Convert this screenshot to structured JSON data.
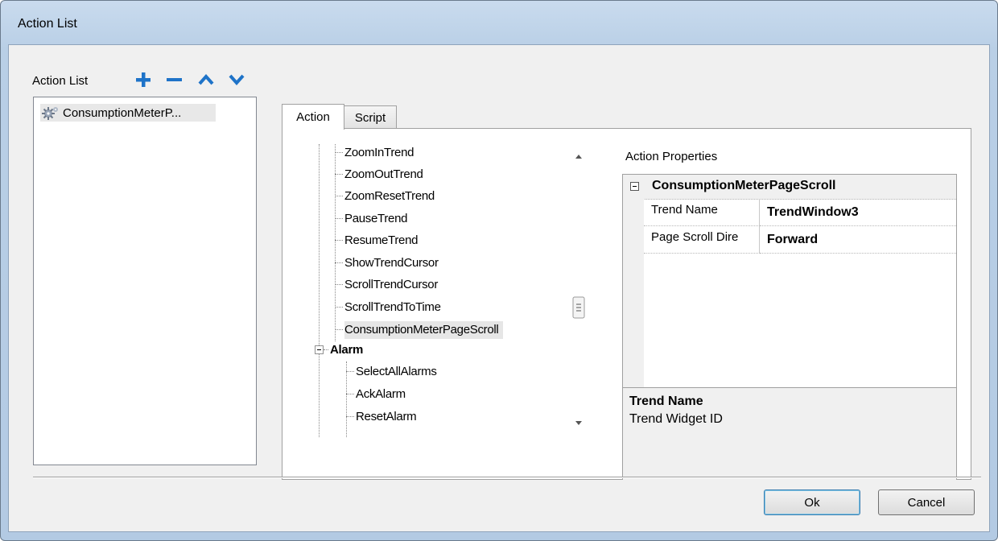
{
  "window": {
    "title": "Action List"
  },
  "toolbar": {
    "label": "Action List",
    "add_icon": "plus-icon",
    "remove_icon": "minus-icon",
    "up_icon": "chevron-up-icon",
    "down_icon": "chevron-down-icon",
    "accent": "#1e73c8"
  },
  "action_list": {
    "items": [
      {
        "label": "ConsumptionMeterP...",
        "icon": "gear-icon"
      }
    ]
  },
  "tabs": [
    {
      "label": "Action",
      "active": true
    },
    {
      "label": "Script",
      "active": false
    }
  ],
  "tree": {
    "items": [
      {
        "label": "ZoomInTrend"
      },
      {
        "label": "ZoomOutTrend"
      },
      {
        "label": "ZoomResetTrend"
      },
      {
        "label": "PauseTrend"
      },
      {
        "label": "ResumeTrend"
      },
      {
        "label": "ShowTrendCursor"
      },
      {
        "label": "ScrollTrendCursor"
      },
      {
        "label": "ScrollTrendToTime"
      },
      {
        "label": "ConsumptionMeterPageScroll",
        "selected": true
      },
      {
        "label": "Alarm",
        "group": true
      },
      {
        "label": "SelectAllAlarms"
      },
      {
        "label": "AckAlarm"
      },
      {
        "label": "ResetAlarm"
      }
    ]
  },
  "properties": {
    "heading": "Action Properties",
    "category": "ConsumptionMeterPageScroll",
    "rows": [
      {
        "name": "Trend Name",
        "value": "TrendWindow3"
      },
      {
        "name": "Page Scroll Dire",
        "value": "Forward"
      }
    ],
    "description_title": "Trend Name",
    "description_text": "Trend Widget ID"
  },
  "buttons": {
    "ok": "Ok",
    "cancel": "Cancel"
  }
}
